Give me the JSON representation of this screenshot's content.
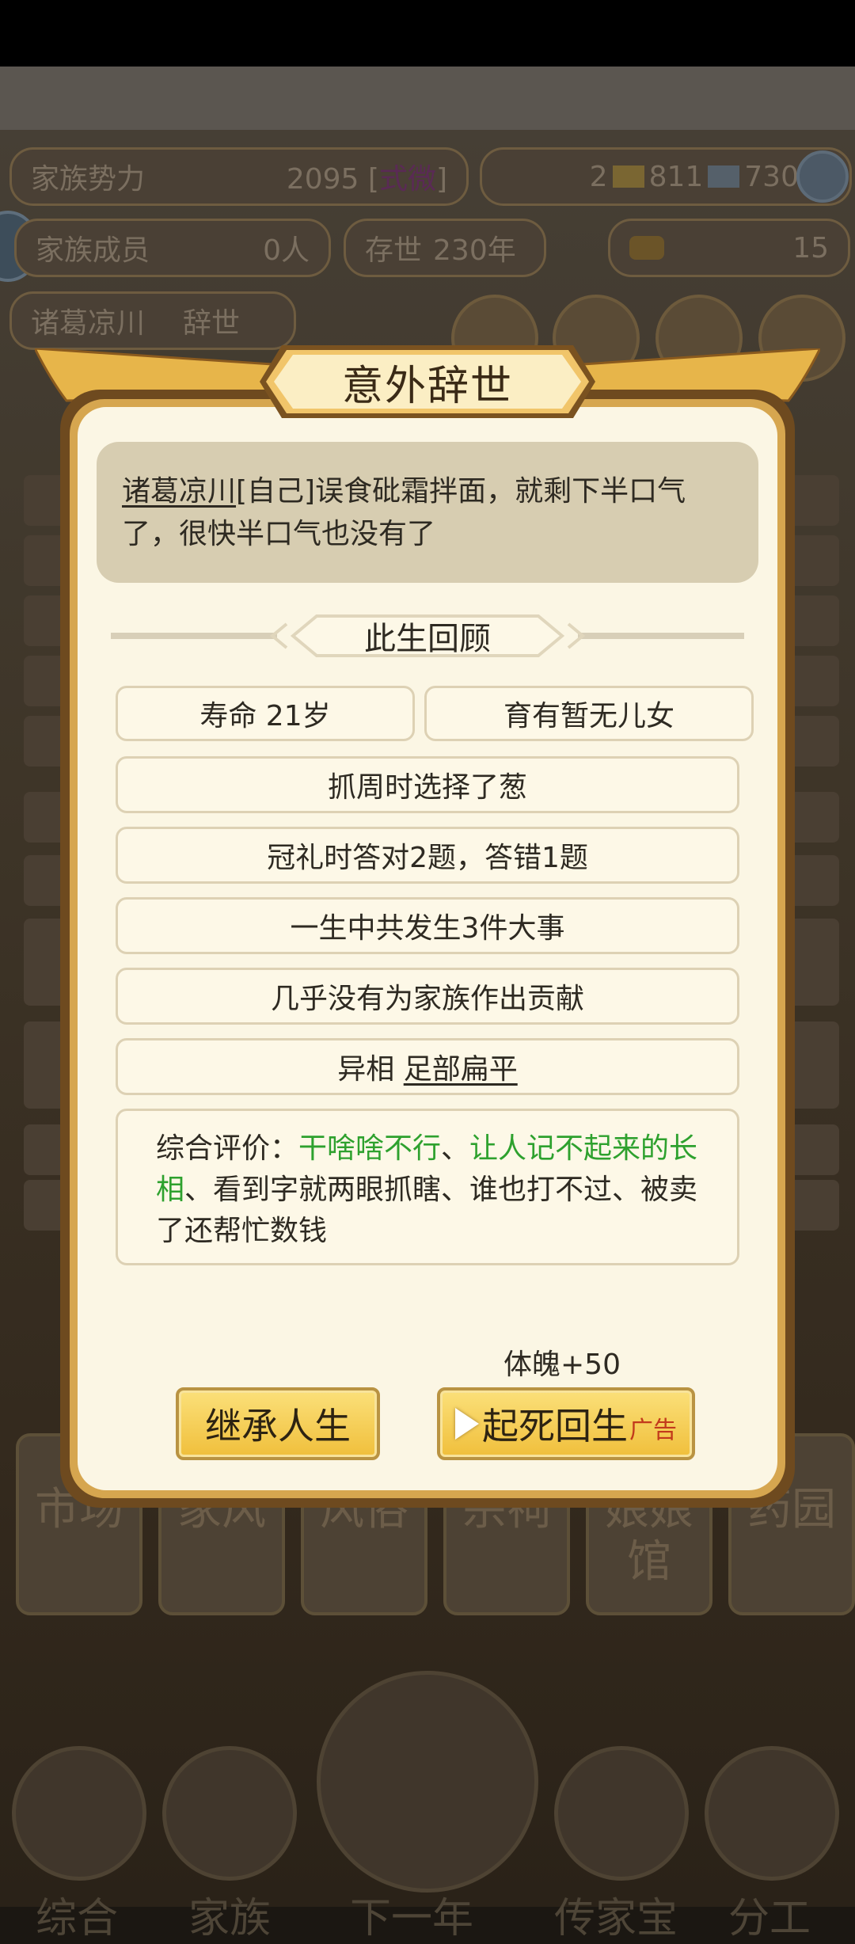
{
  "background": {
    "family_power_label": "家族势力",
    "family_power_value": "2095 [",
    "family_power_rank": "式微",
    "family_power_close": "]",
    "currency_gold": "2",
    "currency_silver": "811",
    "currency_blue": "730",
    "members_label": "家族成员",
    "members_value": "0人",
    "survived_label": "存世",
    "survived_value": "230年",
    "ingot_value": "15",
    "player_name": "诸葛凉川",
    "player_status": "辞世",
    "tiles": [
      "市场",
      "家风",
      "风俗",
      "宗祠",
      "娘娘馆",
      "药园"
    ],
    "nav": [
      "综合",
      "家族",
      "下一年",
      "传家宝",
      "分工"
    ]
  },
  "modal": {
    "title": "意外辞世",
    "message_name": "诸葛凉川",
    "message_rest": "[自己]误食砒霜拌面，就剩下半口气了，很快半口气也没有了",
    "review_title": "此生回顾",
    "lifespan": "寿命 21岁",
    "children": "育有暂无儿女",
    "zhuazhou": "抓周时选择了葱",
    "guanli": "冠礼时答对2题，答错1题",
    "events": "一生中共发生3件大事",
    "contribution": "几乎没有为家族作出贡献",
    "trait_label": "异相",
    "trait_value": "足部扁平",
    "evaluation_label": "综合评价：",
    "evaluation_green1": "干啥啥不行",
    "evaluation_sep1": "、",
    "evaluation_green2": "让人记不起来的长相",
    "evaluation_rest": "、看到字就两眼抓瞎、谁也打不过、被卖了还帮忙数钱",
    "reward": "体魄+50",
    "inherit_button": "继承人生",
    "revive_button": "起死回生",
    "ad_tag": "广告"
  },
  "colors": {
    "accent_gold": "#d6a64f",
    "panel_bg": "#fbf6e4",
    "green_text": "#2ea12e",
    "ad_red": "#c23a1c"
  }
}
